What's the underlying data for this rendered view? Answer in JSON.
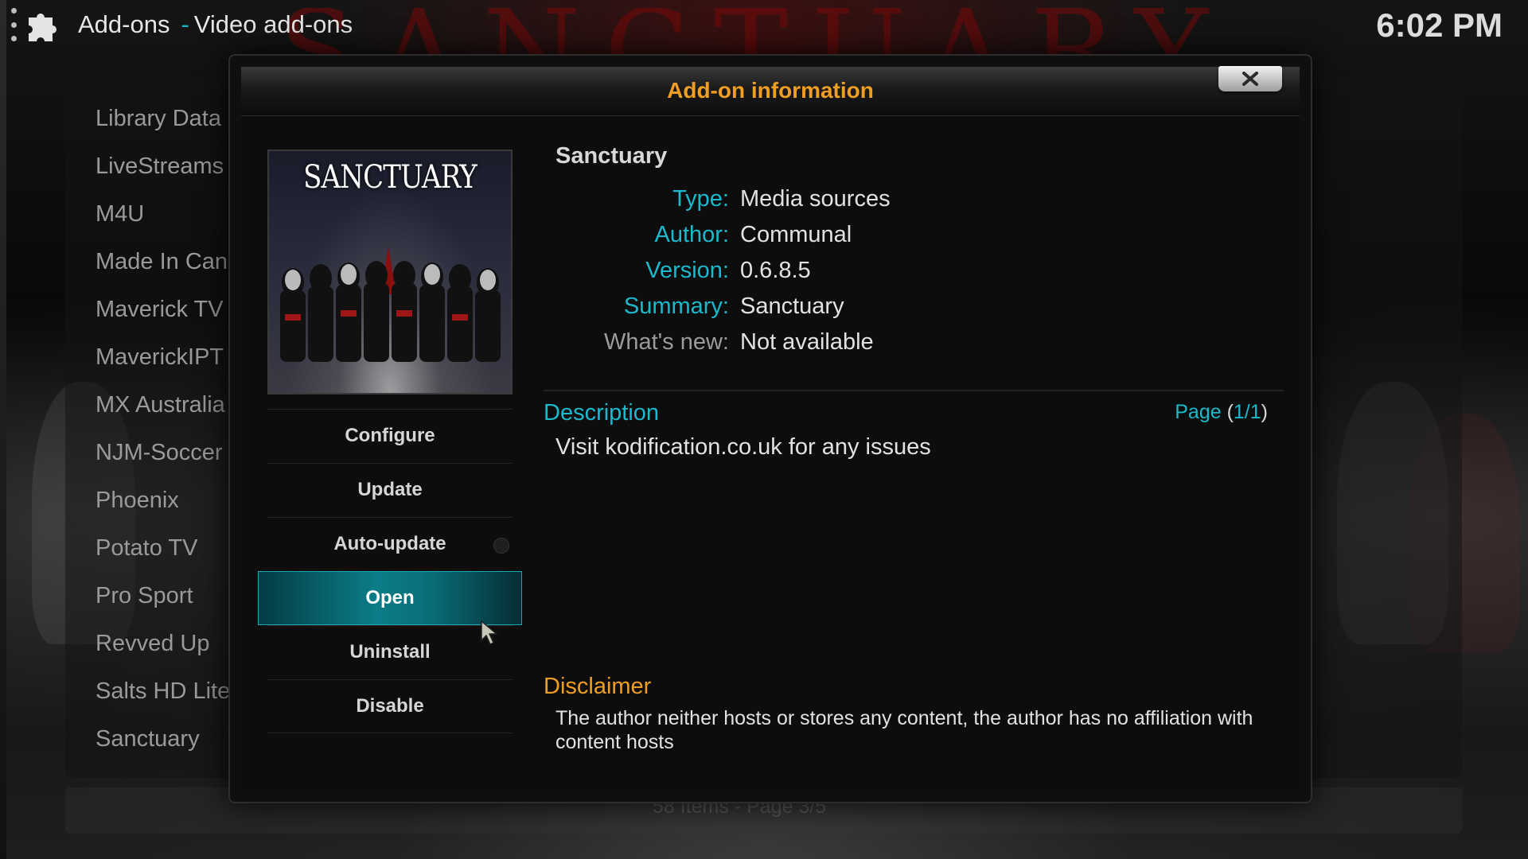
{
  "header": {
    "section": "Add-ons",
    "separator": "-",
    "subsection": "Video add-ons",
    "clock": "6:02 PM"
  },
  "background": {
    "watermark_text": "SANCTUARY",
    "list_items": [
      "Library Data",
      "LiveStreams",
      "M4U",
      "Made In Can",
      "Maverick TV",
      "MaverickIPT",
      "MX Australia",
      "NJM-Soccer",
      "Phoenix",
      "Potato TV",
      "Pro Sport",
      "Revved Up",
      "Salts HD Lite",
      "Sanctuary"
    ],
    "footer": "58 Items - Page 3/5"
  },
  "dialog": {
    "title": "Add-on information",
    "thumbnail_text": "SANCTUARY",
    "addon_name": "Sanctuary",
    "meta": {
      "type_label": "Type:",
      "type_value": "Media sources",
      "author_label": "Author:",
      "author_value": "Communal",
      "version_label": "Version:",
      "version_value": "0.6.8.5",
      "summary_label": "Summary:",
      "summary_value": "Sanctuary",
      "whatsnew_label": "What's new:",
      "whatsnew_value": "Not available"
    },
    "description_heading": "Description",
    "page_label": "Page",
    "page_open": "(",
    "page_value": "1/1",
    "page_close": ")",
    "description": "Visit kodification.co.uk for any issues",
    "disclaimer_heading": "Disclaimer",
    "disclaimer": "The author neither hosts or stores any content, the author has no affiliation with content hosts",
    "actions": {
      "configure": "Configure",
      "update": "Update",
      "auto_update": "Auto-update",
      "open": "Open",
      "uninstall": "Uninstall",
      "disable": "Disable"
    },
    "auto_update_enabled": false,
    "focused_action": "Open"
  },
  "colors": {
    "accent_cyan": "#1ab9cc",
    "title_orange": "#ee9e22",
    "focus_teal": "#0b7d88"
  },
  "icons": [
    "menu-dots-icon",
    "puzzle-icon",
    "close-icon",
    "mouse-pointer-icon"
  ]
}
